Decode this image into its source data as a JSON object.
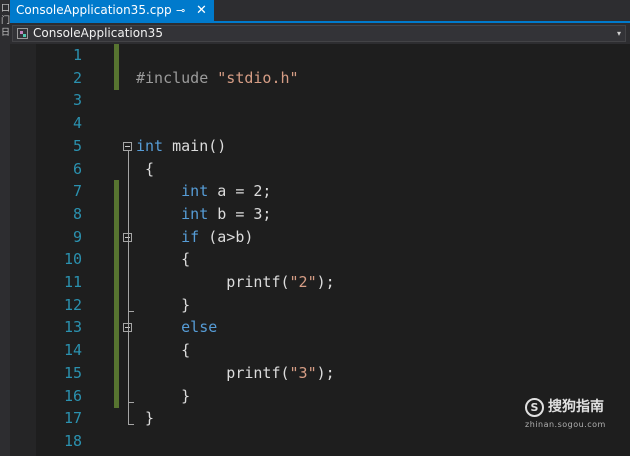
{
  "tab": {
    "title": "ConsoleApplication35.cpp",
    "pin_glyph": "⊸",
    "close_glyph": "✕"
  },
  "navigation": {
    "project": "ConsoleApplication35",
    "dropdown_glyph": "▾"
  },
  "left_strip_glyphs": [
    "口",
    "门",
    "日"
  ],
  "editor": {
    "lines": [
      {
        "number": "1",
        "tokens": []
      },
      {
        "number": "2",
        "tokens": [
          {
            "t": "#include ",
            "c": "pp"
          },
          {
            "t": "\"stdio.h\"",
            "c": "str"
          }
        ]
      },
      {
        "number": "3",
        "tokens": []
      },
      {
        "number": "4",
        "tokens": []
      },
      {
        "number": "5",
        "tokens": [
          {
            "t": "int",
            "c": "kw"
          },
          {
            "t": " main()",
            "c": ""
          }
        ]
      },
      {
        "number": "6",
        "tokens": [
          {
            "t": " {",
            "c": ""
          }
        ]
      },
      {
        "number": "7",
        "tokens": [
          {
            "t": "     ",
            "c": ""
          },
          {
            "t": "int",
            "c": "kw"
          },
          {
            "t": " a = 2;",
            "c": ""
          }
        ]
      },
      {
        "number": "8",
        "tokens": [
          {
            "t": "     ",
            "c": ""
          },
          {
            "t": "int",
            "c": "kw"
          },
          {
            "t": " b = 3;",
            "c": ""
          }
        ]
      },
      {
        "number": "9",
        "tokens": [
          {
            "t": "     ",
            "c": ""
          },
          {
            "t": "if",
            "c": "kw"
          },
          {
            "t": " (a>b)",
            "c": ""
          }
        ]
      },
      {
        "number": "10",
        "tokens": [
          {
            "t": "     {",
            "c": ""
          }
        ]
      },
      {
        "number": "11",
        "tokens": [
          {
            "t": "          printf(",
            "c": ""
          },
          {
            "t": "\"2\"",
            "c": "str"
          },
          {
            "t": ");",
            "c": ""
          }
        ]
      },
      {
        "number": "12",
        "tokens": [
          {
            "t": "     }",
            "c": ""
          }
        ]
      },
      {
        "number": "13",
        "tokens": [
          {
            "t": "     ",
            "c": ""
          },
          {
            "t": "else",
            "c": "kw"
          }
        ]
      },
      {
        "number": "14",
        "tokens": [
          {
            "t": "     {",
            "c": ""
          }
        ]
      },
      {
        "number": "15",
        "tokens": [
          {
            "t": "          printf(",
            "c": ""
          },
          {
            "t": "\"3\"",
            "c": "str"
          },
          {
            "t": ");",
            "c": ""
          }
        ]
      },
      {
        "number": "16",
        "tokens": [
          {
            "t": "     }",
            "c": ""
          }
        ]
      },
      {
        "number": "17",
        "tokens": [
          {
            "t": " }",
            "c": ""
          }
        ]
      },
      {
        "number": "18",
        "tokens": []
      }
    ],
    "changed_lines": [
      "1",
      "2",
      "7",
      "8",
      "9",
      "10",
      "11",
      "12",
      "13",
      "14",
      "15",
      "16"
    ],
    "outline_collapse_lines": [
      "5",
      "9",
      "13"
    ]
  },
  "watermark": {
    "logo_glyph": "S",
    "text": "搜狗指南",
    "url": "zhinan.sogou.com"
  },
  "colors": {
    "tab_active": "#007acc",
    "background": "#1e1e1e",
    "keyword": "#569cd6",
    "string": "#d69d85",
    "line_number": "#2b91af",
    "change_bar": "#577430"
  }
}
